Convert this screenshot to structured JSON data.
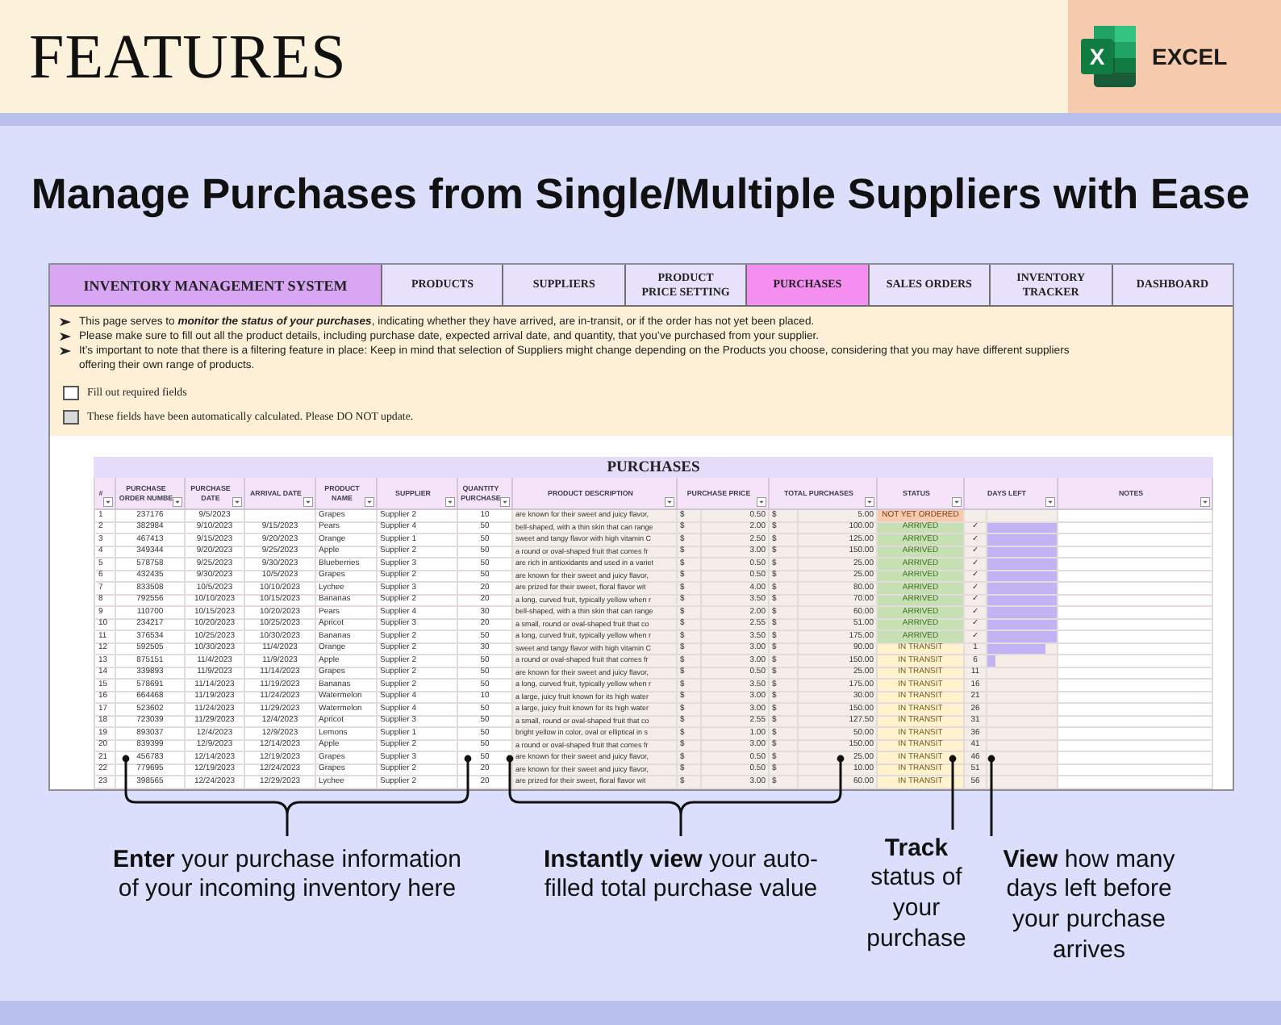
{
  "header": {
    "title": "FEATURES",
    "logo_letter": "X",
    "badge": "EXCEL"
  },
  "subtitle": "Manage Purchases from Single/Multiple Suppliers with Ease",
  "sheet": {
    "nav_title": "INVENTORY MANAGEMENT SYSTEM",
    "tabs": [
      {
        "label": "PRODUCTS",
        "selected": false
      },
      {
        "label": "SUPPLIERS",
        "selected": false
      },
      {
        "label": "PRODUCT\nPRICE SETTING",
        "selected": false
      },
      {
        "label": "PURCHASES",
        "selected": true
      },
      {
        "label": "SALES ORDERS",
        "selected": false
      },
      {
        "label": "INVENTORY\nTRACKER",
        "selected": false
      },
      {
        "label": "DASHBOARD",
        "selected": false
      }
    ],
    "notes": [
      "This page serves to **monitor the status of your purchases**, indicating whether they have arrived, are in-transit, or if the order has not yet been placed.",
      "Please make sure to fill out all the product details, including purchase date, expected arrival date, and quantity, that you’ve purchased from your supplier.",
      "It’s important to note that there is a filtering feature in place: Keep in mind that selection of Suppliers might change depending on the Products you choose, considering that you may have different suppliers offering their own range of products."
    ],
    "legend": [
      {
        "kind": "required",
        "label": "Fill out required fields"
      },
      {
        "kind": "calculated",
        "label": "These fields have been automatically calculated. Please DO NOT update."
      }
    ],
    "table": {
      "title": "PURCHASES",
      "columns": [
        "#",
        "PURCHASE ORDER NUMBE",
        "PURCHASE DATE",
        "ARRIVAL DATE",
        "PRODUCT NAME",
        "SUPPLIER",
        "QUANTITY PURCHASE",
        "PRODUCT DESCRIPTION",
        "PURCHASE PRICE",
        "TOTAL PURCHASES",
        "STATUS",
        "DAYS LEFT",
        "NOTES"
      ],
      "rows": [
        {
          "no": "1",
          "order": "237176",
          "purchase_date": "9/5/2023",
          "product": "Grapes",
          "supplier": "Supplier 2",
          "quantity": "10",
          "description": "are known for their sweet and juicy flavor,",
          "price_symbol": "$",
          "price": "0.50",
          "total_symbol": "$",
          "total": "5.00",
          "status": {
            "label": "NOT YET ORDERED",
            "color": "#f8cbad"
          }
        },
        {
          "no": "2",
          "order": "382984",
          "purchase_date": "9/10/2023",
          "arrival_date": "9/15/2023",
          "product": "Pears",
          "supplier": "Supplier 4",
          "quantity": "50",
          "description": "bell-shaped, with a thin skin that can range",
          "price_symbol": "$",
          "price": "2.00",
          "total_symbol": "$",
          "total": "100.00",
          "status": {
            "label": "ARRIVED",
            "color": "#c6e0b4"
          },
          "days_left": "✓",
          "days_bar": {
            "level": 1
          }
        },
        {
          "no": "3",
          "order": "467413",
          "purchase_date": "9/15/2023",
          "arrival_date": "9/20/2023",
          "product": "Orange",
          "supplier": "Supplier 1",
          "quantity": "50",
          "description": "sweet and tangy flavor with high vitamin C",
          "price_symbol": "$",
          "price": "2.50",
          "total_symbol": "$",
          "total": "125.00",
          "status": {
            "label": "ARRIVED",
            "color": "#c6e0b4"
          },
          "days_left": "✓",
          "days_bar": {
            "level": 1
          }
        },
        {
          "no": "4",
          "order": "349344",
          "purchase_date": "9/20/2023",
          "arrival_date": "9/25/2023",
          "product": "Apple",
          "supplier": "Supplier 2",
          "quantity": "50",
          "description": "a round or oval-shaped fruit that comes fr",
          "price_symbol": "$",
          "price": "3.00",
          "total_symbol": "$",
          "total": "150.00",
          "status": {
            "label": "ARRIVED",
            "color": "#c6e0b4"
          },
          "days_left": "✓",
          "days_bar": {
            "level": 1
          }
        },
        {
          "no": "5",
          "order": "578758",
          "purchase_date": "9/25/2023",
          "arrival_date": "9/30/2023",
          "product": "Blueberries",
          "supplier": "Supplier 3",
          "quantity": "50",
          "description": "are rich in antioxidants and used in a variet",
          "price_symbol": "$",
          "price": "0.50",
          "total_symbol": "$",
          "total": "25.00",
          "status": {
            "label": "ARRIVED",
            "color": "#c6e0b4"
          },
          "days_left": "✓",
          "days_bar": {
            "level": 1
          }
        },
        {
          "no": "6",
          "order": "432435",
          "purchase_date": "9/30/2023",
          "arrival_date": "10/5/2023",
          "product": "Grapes",
          "supplier": "Supplier 2",
          "quantity": "50",
          "description": "are known for their sweet and juicy flavor,",
          "price_symbol": "$",
          "price": "0.50",
          "total_symbol": "$",
          "total": "25.00",
          "status": {
            "label": "ARRIVED",
            "color": "#c6e0b4"
          },
          "days_left": "✓",
          "days_bar": {
            "level": 1
          }
        },
        {
          "no": "7",
          "order": "833508",
          "purchase_date": "10/5/2023",
          "arrival_date": "10/10/2023",
          "product": "Lychee",
          "supplier": "Supplier 3",
          "quantity": "20",
          "description": "are prized for their sweet, floral flavor wit",
          "price_symbol": "$",
          "price": "4.00",
          "total_symbol": "$",
          "total": "80.00",
          "status": {
            "label": "ARRIVED",
            "color": "#c6e0b4"
          },
          "days_left": "✓",
          "days_bar": {
            "level": 1
          }
        },
        {
          "no": "8",
          "order": "792556",
          "purchase_date": "10/10/2023",
          "arrival_date": "10/15/2023",
          "product": "Bananas",
          "supplier": "Supplier 2",
          "quantity": "20",
          "description": "a long, curved fruit, typically yellow when r",
          "price_symbol": "$",
          "price": "3.50",
          "total_symbol": "$",
          "total": "70.00",
          "status": {
            "label": "ARRIVED",
            "color": "#c6e0b4"
          },
          "days_left": "✓",
          "days_bar": {
            "level": 1
          }
        },
        {
          "no": "9",
          "order": "110700",
          "purchase_date": "10/15/2023",
          "arrival_date": "10/20/2023",
          "product": "Pears",
          "supplier": "Supplier 4",
          "quantity": "30",
          "description": "bell-shaped, with a thin skin that can range",
          "price_symbol": "$",
          "price": "2.00",
          "total_symbol": "$",
          "total": "60.00",
          "status": {
            "label": "ARRIVED",
            "color": "#c6e0b4"
          },
          "days_left": "✓",
          "days_bar": {
            "level": 1
          }
        },
        {
          "no": "10",
          "order": "234217",
          "purchase_date": "10/20/2023",
          "arrival_date": "10/25/2023",
          "product": "Apricot",
          "supplier": "Supplier 3",
          "quantity": "20",
          "description": "a small, round or oval-shaped fruit that co",
          "price_symbol": "$",
          "price": "2.55",
          "total_symbol": "$",
          "total": "51.00",
          "status": {
            "label": "ARRIVED",
            "color": "#c6e0b4"
          },
          "days_left": "✓",
          "days_bar": {
            "level": 1
          }
        },
        {
          "no": "11",
          "order": "376534",
          "purchase_date": "10/25/2023",
          "arrival_date": "10/30/2023",
          "product": "Bananas",
          "supplier": "Supplier 2",
          "quantity": "50",
          "description": "a long, curved fruit, typically yellow when r",
          "price_symbol": "$",
          "price": "3.50",
          "total_symbol": "$",
          "total": "175.00",
          "status": {
            "label": "ARRIVED",
            "color": "#c6e0b4"
          },
          "days_left": "✓",
          "days_bar": {
            "level": 1
          }
        },
        {
          "no": "12",
          "order": "592505",
          "purchase_date": "10/30/2023",
          "arrival_date": "11/4/2023",
          "product": "Orange",
          "supplier": "Supplier 2",
          "quantity": "30",
          "description": "sweet and tangy flavor with high vitamin C",
          "price_symbol": "$",
          "price": "3.00",
          "total_symbol": "$",
          "total": "90.00",
          "status": {
            "label": "IN TRANSIT",
            "color": "#fff2cc"
          },
          "days_left": "1",
          "days_bar": {
            "level": 0.84
          }
        },
        {
          "no": "13",
          "order": "875151",
          "purchase_date": "11/4/2023",
          "arrival_date": "11/9/2023",
          "product": "Apple",
          "supplier": "Supplier 2",
          "quantity": "50",
          "description": "a round or oval-shaped fruit that comes fr",
          "price_symbol": "$",
          "price": "3.00",
          "total_symbol": "$",
          "total": "150.00",
          "status": {
            "label": "IN TRANSIT",
            "color": "#fff2cc"
          },
          "days_left": "6",
          "days_bar": {
            "level": 0.12
          }
        },
        {
          "no": "14",
          "order": "339893",
          "purchase_date": "11/9/2023",
          "arrival_date": "11/14/2023",
          "product": "Grapes",
          "supplier": "Supplier 2",
          "quantity": "50",
          "description": "are known for their sweet and juicy flavor,",
          "price_symbol": "$",
          "price": "0.50",
          "total_symbol": "$",
          "total": "25.00",
          "status": {
            "label": "IN TRANSIT",
            "color": "#fff2cc"
          },
          "days_left": "11"
        },
        {
          "no": "15",
          "order": "578691",
          "purchase_date": "11/14/2023",
          "arrival_date": "11/19/2023",
          "product": "Bananas",
          "supplier": "Supplier 2",
          "quantity": "50",
          "description": "a long, curved fruit, typically yellow when r",
          "price_symbol": "$",
          "price": "3.50",
          "total_symbol": "$",
          "total": "175.00",
          "status": {
            "label": "IN TRANSIT",
            "color": "#fff2cc"
          },
          "days_left": "16"
        },
        {
          "no": "16",
          "order": "664468",
          "purchase_date": "11/19/2023",
          "arrival_date": "11/24/2023",
          "product": "Watermelon",
          "supplier": "Supplier 4",
          "quantity": "10",
          "description": "a large, juicy fruit known for its high water",
          "price_symbol": "$",
          "price": "3.00",
          "total_symbol": "$",
          "total": "30.00",
          "status": {
            "label": "IN TRANSIT",
            "color": "#fff2cc"
          },
          "days_left": "21"
        },
        {
          "no": "17",
          "order": "523602",
          "purchase_date": "11/24/2023",
          "arrival_date": "11/29/2023",
          "product": "Watermelon",
          "supplier": "Supplier 4",
          "quantity": "50",
          "description": "a large, juicy fruit known for its high water",
          "price_symbol": "$",
          "price": "3.00",
          "total_symbol": "$",
          "total": "150.00",
          "status": {
            "label": "IN TRANSIT",
            "color": "#fff2cc"
          },
          "days_left": "26"
        },
        {
          "no": "18",
          "order": "723039",
          "purchase_date": "11/29/2023",
          "arrival_date": "12/4/2023",
          "product": "Apricot",
          "supplier": "Supplier 3",
          "quantity": "50",
          "description": "a small, round or oval-shaped fruit that co",
          "price_symbol": "$",
          "price": "2.55",
          "total_symbol": "$",
          "total": "127.50",
          "status": {
            "label": "IN TRANSIT",
            "color": "#fff2cc"
          },
          "days_left": "31"
        },
        {
          "no": "19",
          "order": "893037",
          "purchase_date": "12/4/2023",
          "arrival_date": "12/9/2023",
          "product": "Lemons",
          "supplier": "Supplier 1",
          "quantity": "50",
          "description": "bright yellow in color, oval or elliptical in s",
          "price_symbol": "$",
          "price": "1.00",
          "total_symbol": "$",
          "total": "50.00",
          "status": {
            "label": "IN TRANSIT",
            "color": "#fff2cc"
          },
          "days_left": "36"
        },
        {
          "no": "20",
          "order": "839399",
          "purchase_date": "12/9/2023",
          "arrival_date": "12/14/2023",
          "product": "Apple",
          "supplier": "Supplier 2",
          "quantity": "50",
          "description": "a round or oval-shaped fruit that comes fr",
          "price_symbol": "$",
          "price": "3.00",
          "total_symbol": "$",
          "total": "150.00",
          "status": {
            "label": "IN TRANSIT",
            "color": "#fff2cc"
          },
          "days_left": "41"
        },
        {
          "no": "21",
          "order": "456783",
          "purchase_date": "12/14/2023",
          "arrival_date": "12/19/2023",
          "product": "Grapes",
          "supplier": "Supplier 3",
          "quantity": "50",
          "description": "are known for their sweet and juicy flavor,",
          "price_symbol": "$",
          "price": "0.50",
          "total_symbol": "$",
          "total": "25.00",
          "status": {
            "label": "IN TRANSIT",
            "color": "#fff2cc"
          },
          "days_left": "46"
        },
        {
          "no": "22",
          "order": "779695",
          "purchase_date": "12/19/2023",
          "arrival_date": "12/24/2023",
          "product": "Grapes",
          "supplier": "Supplier 2",
          "quantity": "20",
          "description": "are known for their sweet and juicy flavor,",
          "price_symbol": "$",
          "price": "0.50",
          "total_symbol": "$",
          "total": "10.00",
          "status": {
            "label": "IN TRANSIT",
            "color": "#fff2cc"
          },
          "days_left": "51"
        },
        {
          "no": "23",
          "order": "398565",
          "purchase_date": "12/24/2023",
          "arrival_date": "12/29/2023",
          "product": "Lychee",
          "supplier": "Supplier 2",
          "quantity": "20",
          "description": "are prized for their sweet, floral flavor wit",
          "price_symbol": "$",
          "price": "3.00",
          "total_symbol": "$",
          "total": "60.00",
          "status": {
            "label": "IN TRANSIT",
            "color": "#fff2cc"
          },
          "days_left": "56"
        }
      ]
    }
  },
  "callouts": [
    {
      "text": "**Enter** your purchase information of your incoming inventory here",
      "kind": "bracket"
    },
    {
      "text": "**Instantly view** your auto-filled total purchase value",
      "kind": "bracket"
    },
    {
      "text": "**Track** status of your purchase",
      "kind": "line"
    },
    {
      "text": "**View** how many days left before your purchase arrives",
      "kind": "line"
    }
  ]
}
